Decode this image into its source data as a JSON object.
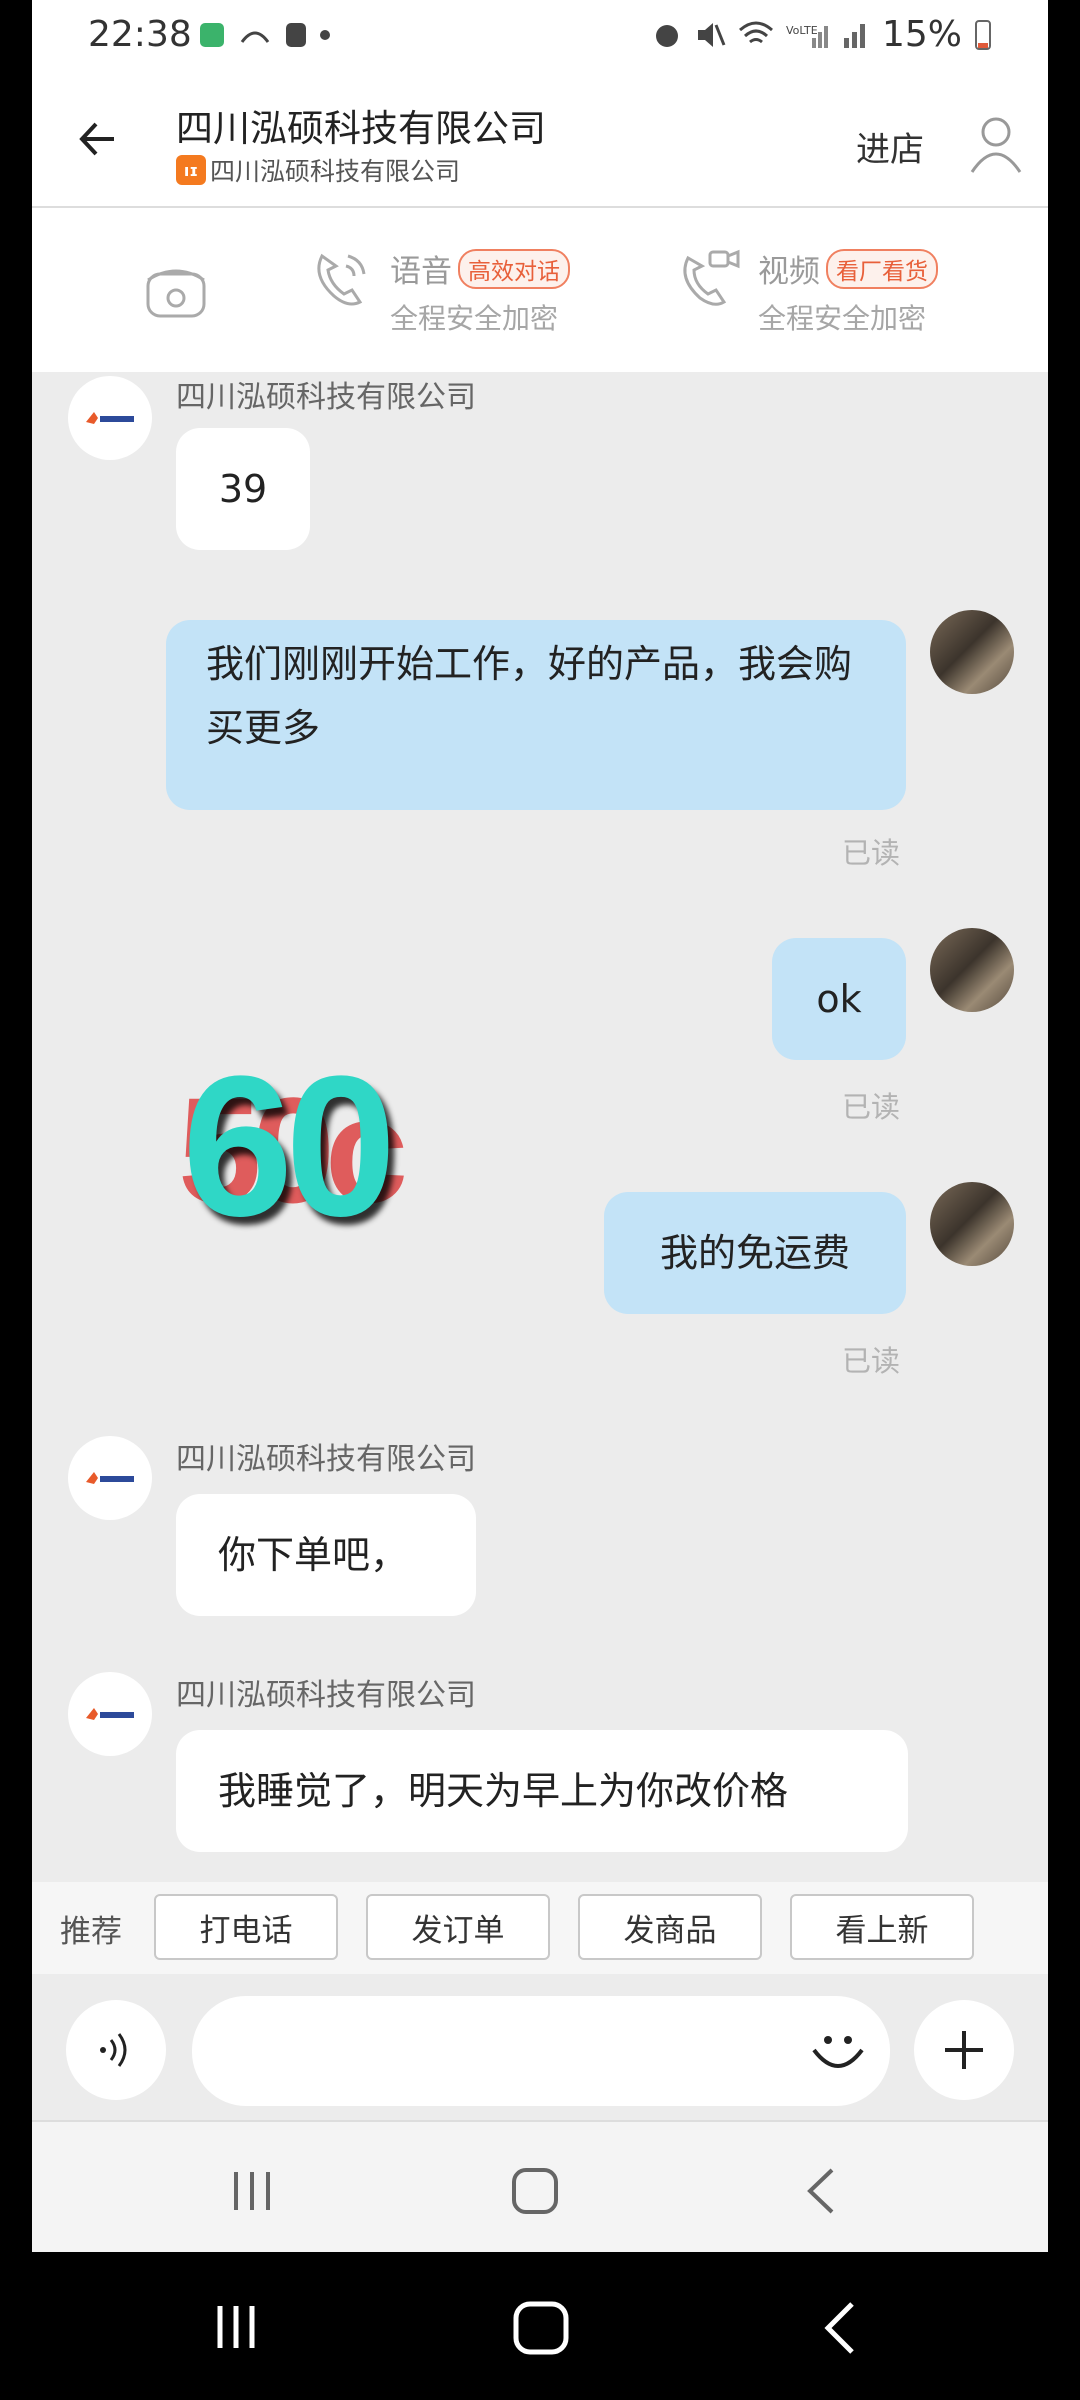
{
  "status_bar": {
    "time": "22:38",
    "battery": "15%"
  },
  "header": {
    "title": "四川泓硕科技有限公司",
    "subtitle": "四川泓硕科技有限公司",
    "enter_store": "进店"
  },
  "call_options": {
    "voice": {
      "label": "语音",
      "tag": "高效对话",
      "note": "全程安全加密"
    },
    "video": {
      "label": "视频",
      "tag": "看厂看货",
      "note": "全程安全加密"
    }
  },
  "messages": [
    {
      "side": "in",
      "sender": "四川泓硕科技有限公司",
      "text": "39"
    },
    {
      "side": "out",
      "text": "我们刚刚开始工作，好的产品，我会购买更多",
      "status": "已读"
    },
    {
      "side": "out",
      "text": "ok",
      "status": "已读"
    },
    {
      "side": "out",
      "text": "我的免运费",
      "status": "已读"
    },
    {
      "side": "in",
      "sender": "四川泓硕科技有限公司",
      "text": "你下单吧，"
    },
    {
      "side": "in",
      "sender": "四川泓硕科技有限公司",
      "text": "我睡觉了，明天为早上为你改价格"
    }
  ],
  "overlay": {
    "big_number": "60",
    "behind_number": "50c"
  },
  "quick_actions": {
    "label": "推荐",
    "buttons": [
      "打电话",
      "发订单",
      "发商品",
      "看上新"
    ]
  },
  "colors": {
    "accent": "#f47a1f",
    "outgoing_bubble": "#c3e3f7",
    "overlay_number": "#2fd7c6"
  }
}
